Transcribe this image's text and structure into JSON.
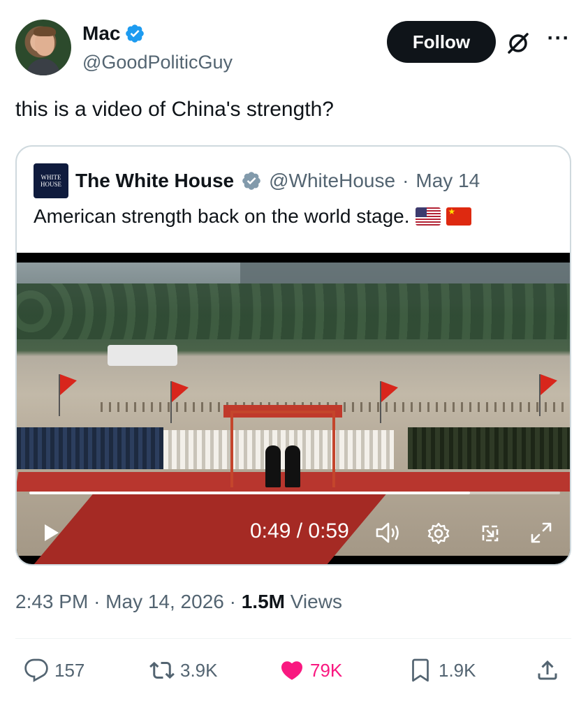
{
  "author": {
    "name": "Mac",
    "handle": "@GoodPoliticGuy",
    "follow_label": "Follow"
  },
  "tweet": {
    "text": "this is a video of China's strength?",
    "time": "2:43 PM",
    "date": "May 14, 2026",
    "views_count": "1.5M",
    "views_label": "Views"
  },
  "quote": {
    "logo_text": "WHITE HOUSE",
    "name": "The White House",
    "handle": "@WhiteHouse",
    "date": "May 14",
    "text": "American strength back on the world stage.",
    "flags": [
      "us-flag",
      "china-flag"
    ]
  },
  "video": {
    "time_label": "0:49 / 0:59",
    "progress": 0.83
  },
  "actions": {
    "replies": "157",
    "reposts": "3.9K",
    "likes": "79K",
    "bookmarks": "1.9K"
  },
  "colors": {
    "verified": "#1d9bf0",
    "like": "#f91880",
    "secondary_text": "#536471"
  }
}
